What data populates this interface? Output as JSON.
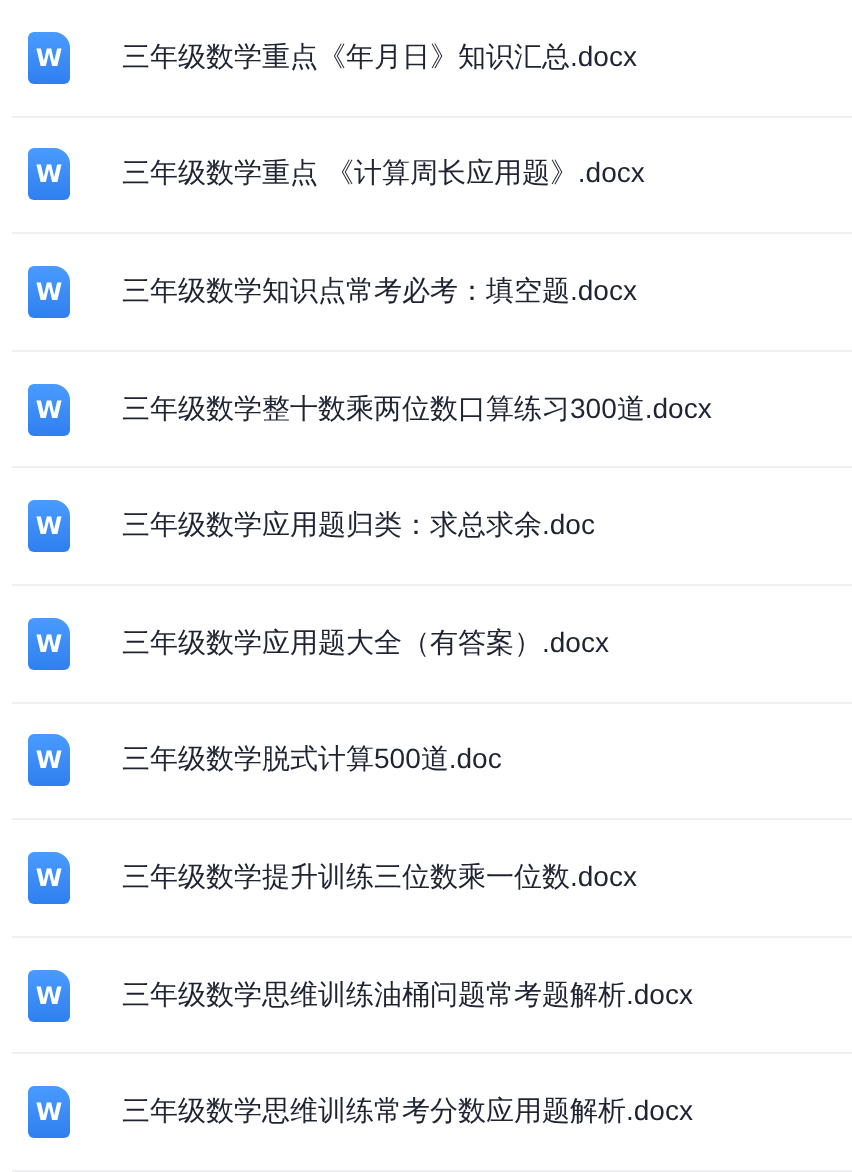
{
  "files": [
    {
      "icon_label": "W",
      "name": "三年级数学重点《年月日》知识汇总.docx"
    },
    {
      "icon_label": "W",
      "name": "三年级数学重点 《计算周长应用题》.docx"
    },
    {
      "icon_label": "W",
      "name": "三年级数学知识点常考必考：填空题.docx"
    },
    {
      "icon_label": "W",
      "name": "三年级数学整十数乘两位数口算练习300道.docx"
    },
    {
      "icon_label": "W",
      "name": "三年级数学应用题归类：求总求余.doc"
    },
    {
      "icon_label": "W",
      "name": "三年级数学应用题大全（有答案）.docx"
    },
    {
      "icon_label": "W",
      "name": "三年级数学脱式计算500道.doc"
    },
    {
      "icon_label": "W",
      "name": "三年级数学提升训练三位数乘一位数.docx"
    },
    {
      "icon_label": "W",
      "name": "三年级数学思维训练油桶问题常考题解析.docx"
    },
    {
      "icon_label": "W",
      "name": "三年级数学思维训练常考分数应用题解析.docx"
    }
  ]
}
